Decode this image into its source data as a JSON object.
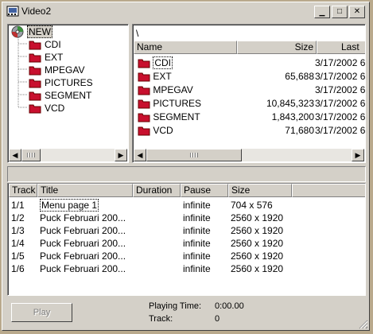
{
  "window": {
    "title": "Video2",
    "minimize_glyph": "▁",
    "maximize_glyph": "□",
    "close_glyph": "✕"
  },
  "tree": {
    "root": "NEW",
    "items": [
      "CDI",
      "EXT",
      "MPEGAV",
      "PICTURES",
      "SEGMENT",
      "VCD"
    ]
  },
  "file_list": {
    "path": "\\",
    "columns": [
      "Name",
      "Size",
      "Last"
    ],
    "rows": [
      {
        "name": "CDI",
        "size": "",
        "date": "3/17/2002 6"
      },
      {
        "name": "EXT",
        "size": "65,688",
        "date": "3/17/2002 6"
      },
      {
        "name": "MPEGAV",
        "size": "",
        "date": "3/17/2002 6"
      },
      {
        "name": "PICTURES",
        "size": "10,845,323",
        "date": "3/17/2002 6"
      },
      {
        "name": "SEGMENT",
        "size": "1,843,200",
        "date": "3/17/2002 6"
      },
      {
        "name": "VCD",
        "size": "71,680",
        "date": "3/17/2002 6"
      }
    ]
  },
  "tracks": {
    "columns": [
      "Track",
      "Title",
      "Duration",
      "Pause",
      "Size"
    ],
    "rows": [
      {
        "track": "1/1",
        "title": "Menu page 1",
        "duration": "",
        "pause": "infinite",
        "size": "704 x 576"
      },
      {
        "track": "1/2",
        "title": "Puck Februari 200...",
        "duration": "",
        "pause": "infinite",
        "size": "2560 x 1920"
      },
      {
        "track": "1/3",
        "title": "Puck Februari 200...",
        "duration": "",
        "pause": "infinite",
        "size": "2560 x 1920"
      },
      {
        "track": "1/4",
        "title": "Puck Februari 200...",
        "duration": "",
        "pause": "infinite",
        "size": "2560 x 1920"
      },
      {
        "track": "1/5",
        "title": "Puck Februari 200...",
        "duration": "",
        "pause": "infinite",
        "size": "2560 x 1920"
      },
      {
        "track": "1/6",
        "title": "Puck Februari 200...",
        "duration": "",
        "pause": "infinite",
        "size": "2560 x 1920"
      }
    ]
  },
  "footer": {
    "play_label": "Play",
    "playing_time_label": "Playing Time:",
    "playing_time_value": "0:00.00",
    "track_label": "Track:",
    "track_value": "0"
  },
  "colors": {
    "folder": "#c8102e",
    "face": "#d4d0c8",
    "background": "#b9a98c"
  }
}
